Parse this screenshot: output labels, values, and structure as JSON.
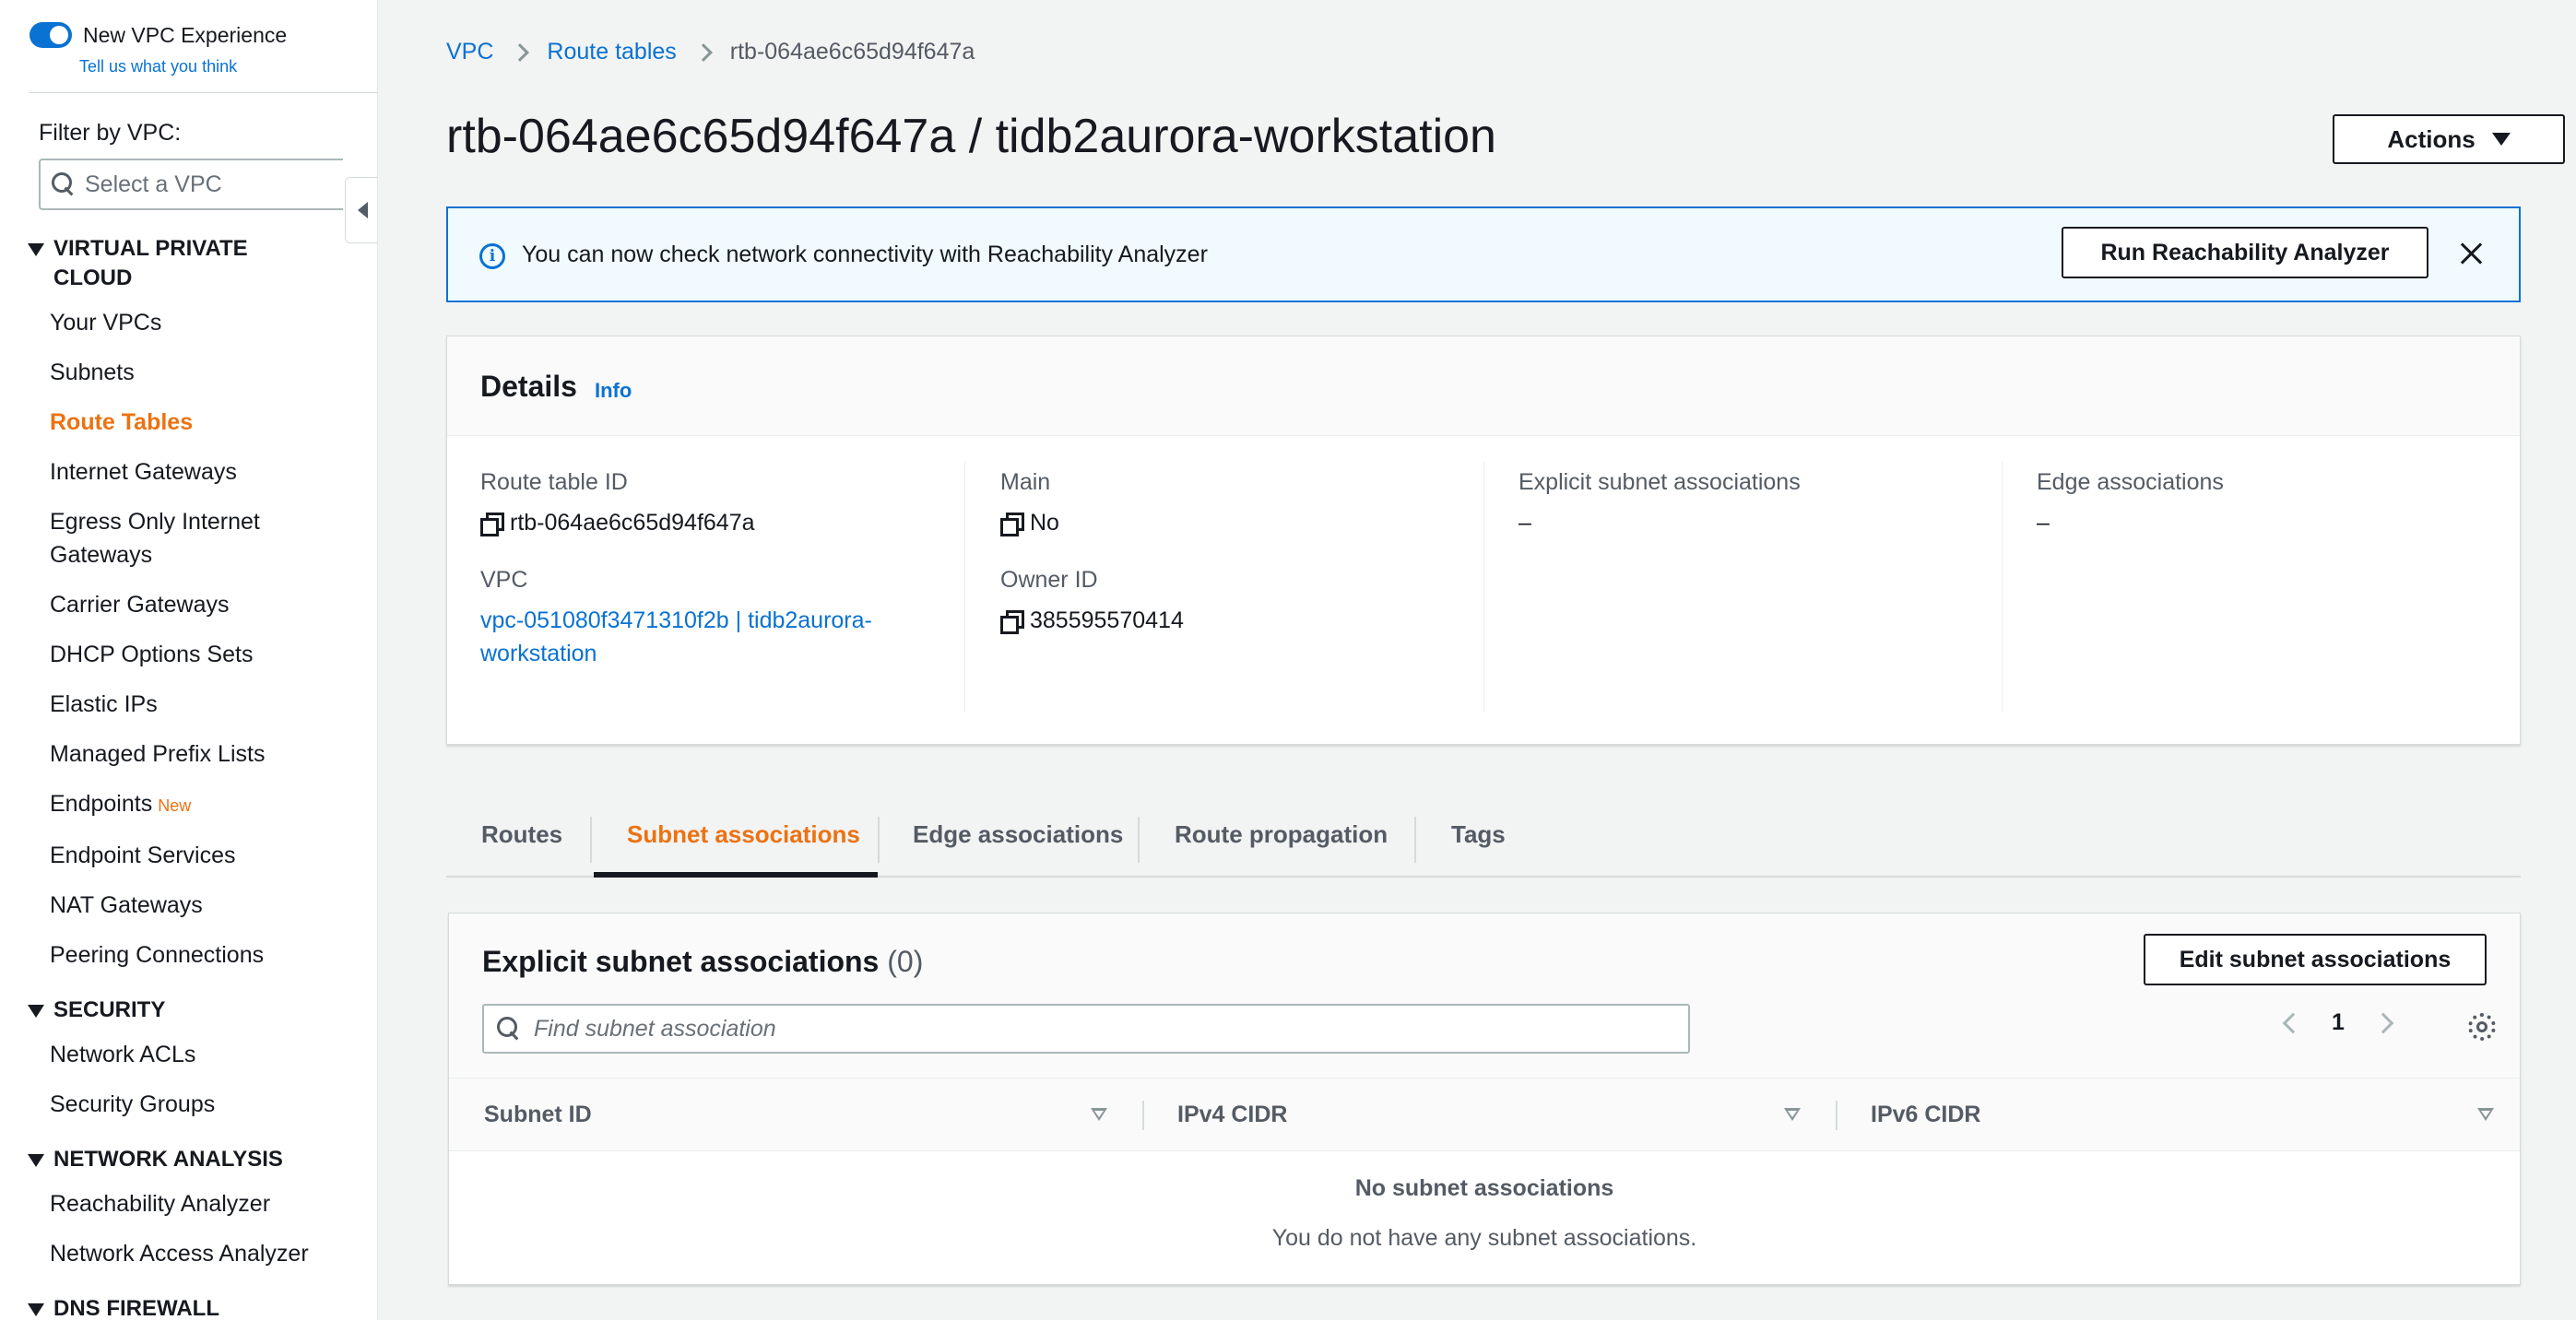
{
  "sidebar": {
    "toggle_label": "New VPC Experience",
    "feedback_link": "Tell us what you think",
    "filter_label": "Filter by VPC:",
    "vpc_select_placeholder": "Select a VPC",
    "sections": [
      {
        "title_line1": "VIRTUAL PRIVATE",
        "title_line2": "CLOUD",
        "items": [
          {
            "label": "Your VPCs"
          },
          {
            "label": "Subnets"
          },
          {
            "label": "Route Tables"
          },
          {
            "label": "Internet Gateways"
          },
          {
            "label_line1": "Egress Only Internet",
            "label_line2": "Gateways"
          },
          {
            "label": "Carrier Gateways"
          },
          {
            "label": "DHCP Options Sets"
          },
          {
            "label": "Elastic IPs"
          },
          {
            "label": "Managed Prefix Lists"
          },
          {
            "label": "Endpoints",
            "badge": "New"
          },
          {
            "label": "Endpoint Services"
          },
          {
            "label": "NAT Gateways"
          },
          {
            "label": "Peering Connections"
          }
        ]
      },
      {
        "title": "SECURITY",
        "items": [
          {
            "label": "Network ACLs"
          },
          {
            "label": "Security Groups"
          }
        ]
      },
      {
        "title": "NETWORK ANALYSIS",
        "items": [
          {
            "label": "Reachability Analyzer"
          },
          {
            "label": "Network Access Analyzer"
          }
        ]
      },
      {
        "title": "DNS FIREWALL"
      }
    ]
  },
  "breadcrumb": {
    "items": [
      "VPC",
      "Route tables",
      "rtb-064ae6c65d94f647a"
    ]
  },
  "page": {
    "title": "rtb-064ae6c65d94f647a / tidb2aurora-workstation",
    "actions_label": "Actions"
  },
  "flash": {
    "message": "You can now check network connectivity with Reachability Analyzer",
    "button_label": "Run Reachability Analyzer",
    "info_glyph": "i"
  },
  "details": {
    "title": "Details",
    "info_link": "Info",
    "route_table_id": {
      "label": "Route table ID",
      "value": "rtb-064ae6c65d94f647a"
    },
    "vpc": {
      "label": "VPC",
      "line1": "vpc-051080f3471310f2b | tidb2aurora-",
      "line2": "workstation"
    },
    "main": {
      "label": "Main",
      "value": "No"
    },
    "owner_id": {
      "label": "Owner ID",
      "value": "385595570414"
    },
    "explicit_subnet": {
      "label": "Explicit subnet associations",
      "value": "–"
    },
    "edge": {
      "label": "Edge associations",
      "value": "–"
    }
  },
  "tabs": [
    {
      "label": "Routes"
    },
    {
      "label": "Subnet associations",
      "active": true
    },
    {
      "label": "Edge associations"
    },
    {
      "label": "Route propagation"
    },
    {
      "label": "Tags"
    }
  ],
  "subnet_table": {
    "title": "Explicit subnet associations",
    "count": "(0)",
    "edit_button": "Edit subnet associations",
    "search_placeholder": "Find subnet association",
    "page": "1",
    "columns": [
      "Subnet ID",
      "IPv4 CIDR",
      "IPv6 CIDR"
    ],
    "empty_title": "No subnet associations",
    "empty_desc": "You do not have any subnet associations."
  },
  "colors": {
    "accent_orange": "#ec7211",
    "link_blue": "#0972d3",
    "flash_bg": "#f1faff"
  }
}
